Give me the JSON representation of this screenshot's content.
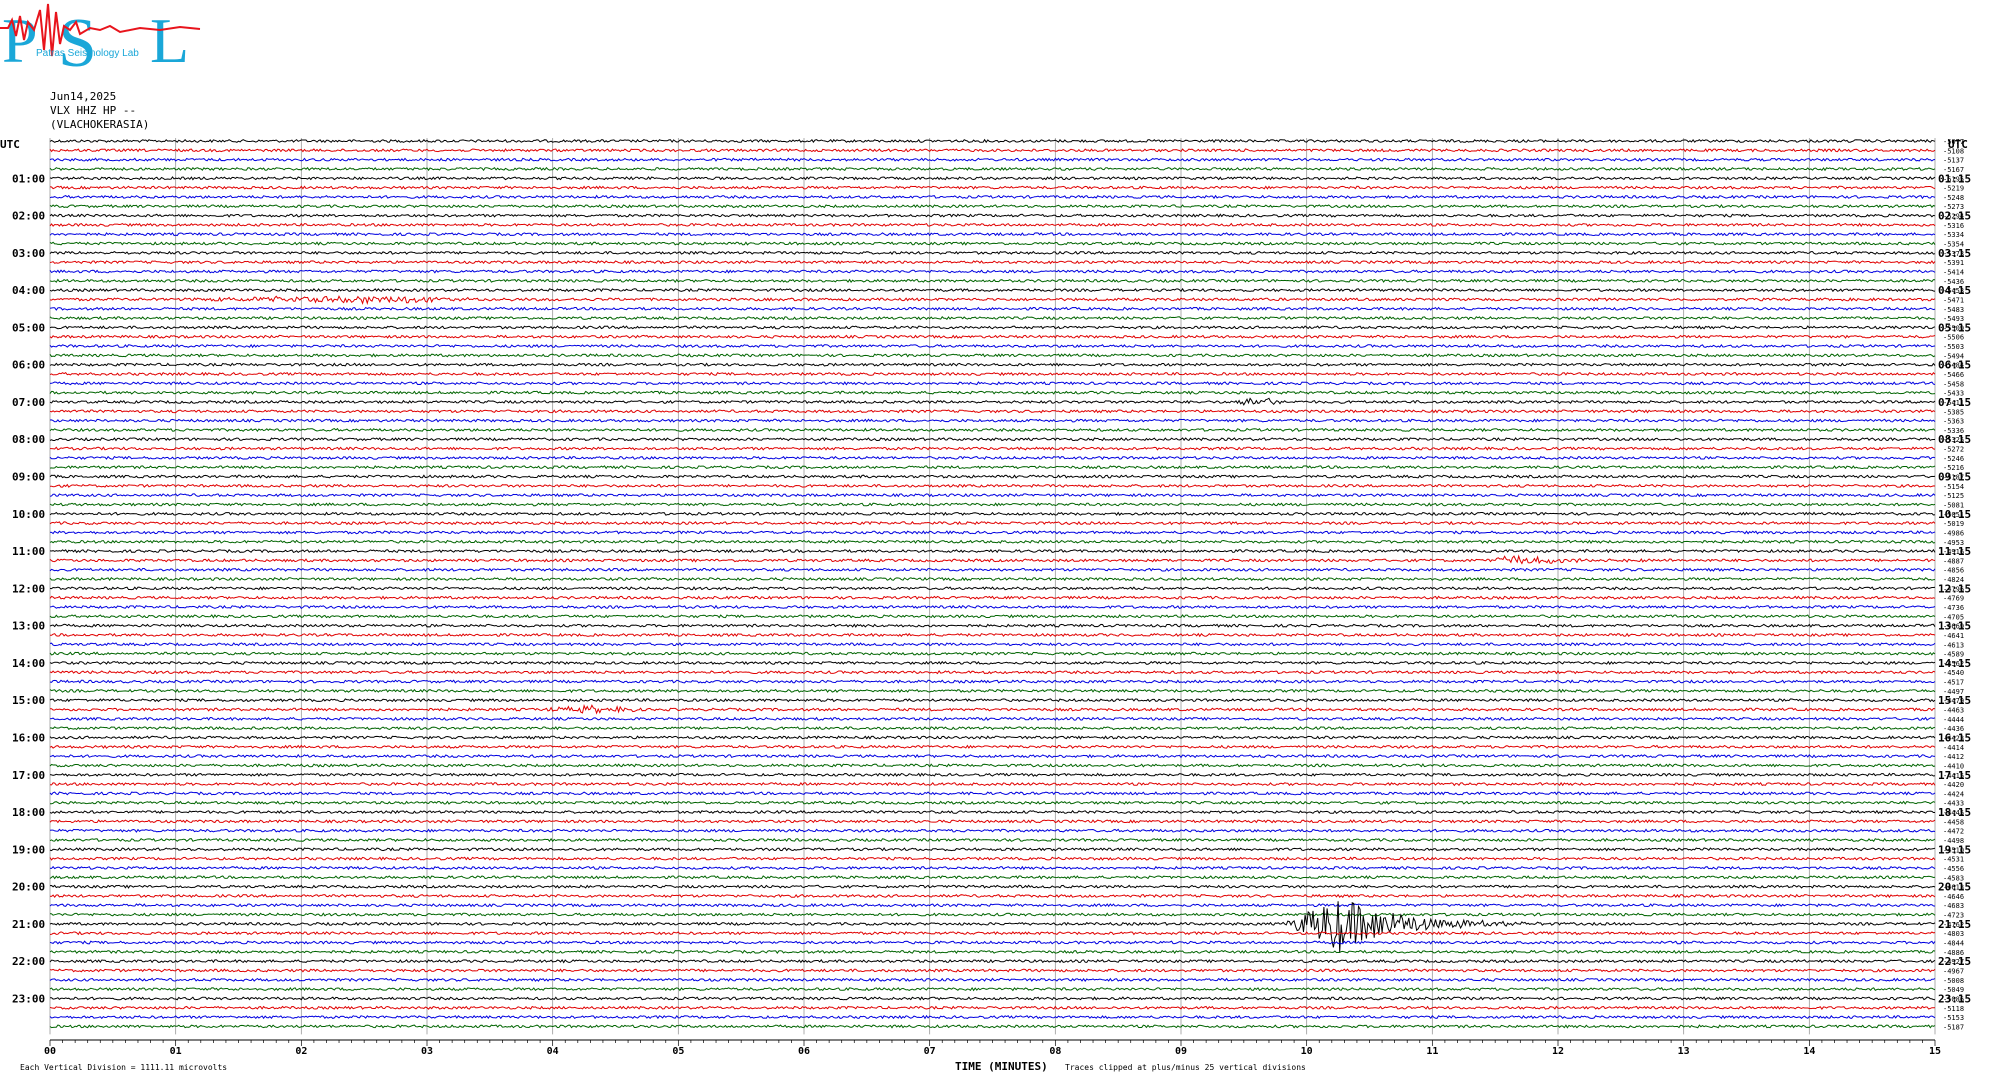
{
  "header": {
    "logo_text": "PSL",
    "logo_subtext": "Patras Seismology Lab",
    "date": "Jun14,2025",
    "channel": "VLX HHZ HP --",
    "station": "(VLACHOKERASIA)"
  },
  "colors": {
    "trace_cycle": [
      "#000000",
      "#e00000",
      "#0000e0",
      "#006400"
    ],
    "logo_red": "#e8141c",
    "logo_cyan": "#1aa7d8"
  },
  "chart_data": {
    "type": "line",
    "title": "",
    "xlabel": "TIME (MINUTES)",
    "ylabel": "",
    "x_ticks": [
      "00",
      "01",
      "02",
      "03",
      "04",
      "05",
      "06",
      "07",
      "08",
      "09",
      "10",
      "11",
      "12",
      "13",
      "14",
      "15"
    ],
    "xlim": [
      0,
      15
    ],
    "left_axis_label": "UTC",
    "right_axis_label": "UTC",
    "left_hour_labels": [
      "01:00",
      "02:00",
      "03:00",
      "04:00",
      "05:00",
      "06:00",
      "07:00",
      "08:00",
      "09:00",
      "10:00",
      "11:00",
      "12:00",
      "13:00",
      "14:00",
      "15:00",
      "16:00",
      "17:00",
      "18:00",
      "19:00",
      "20:00",
      "21:00",
      "22:00",
      "23:00"
    ],
    "right_hour_labels": [
      "01:15",
      "02:15",
      "03:15",
      "04:15",
      "05:15",
      "06:15",
      "07:15",
      "08:15",
      "09:15",
      "10:15",
      "11:15",
      "12:15",
      "13:15",
      "14:15",
      "15:15",
      "16:15",
      "17:15",
      "18:15",
      "19:15",
      "20:15",
      "21:15",
      "22:15",
      "23:15"
    ],
    "trace_offsets": [
      "-5077",
      "-5108",
      "-5137",
      "-5167",
      "-5195",
      "-5219",
      "-5248",
      "-5273",
      "-5294",
      "-5316",
      "-5334",
      "-5354",
      "-5373",
      "-5391",
      "-5414",
      "-5436",
      "-5453",
      "-5471",
      "-5483",
      "-5493",
      "-5509",
      "-5506",
      "-5503",
      "-5494",
      "-5484",
      "-5466",
      "-5458",
      "-5433",
      "-5411",
      "-5385",
      "-5363",
      "-5336",
      "-5325",
      "-5272",
      "-5246",
      "-5216",
      "-5187",
      "-5154",
      "-5125",
      "-5081",
      "-5051",
      "-5019",
      "-4986",
      "-4953",
      "-4916",
      "-4887",
      "-4856",
      "-4824",
      "-4796",
      "-4769",
      "-4736",
      "-4705",
      "-4669",
      "-4641",
      "-4613",
      "-4589",
      "-4562",
      "-4540",
      "-4517",
      "-4497",
      "-4479",
      "-4463",
      "-4444",
      "-4436",
      "-4423",
      "-4414",
      "-4412",
      "-4410",
      "-4415",
      "-4420",
      "-4424",
      "-4433",
      "-4445",
      "-4458",
      "-4472",
      "-4498",
      "-4510",
      "-4531",
      "-4556",
      "-4583",
      "-4613",
      "-4646",
      "-4683",
      "-4723",
      "-4762",
      "-4803",
      "-4844",
      "-4886",
      "-4927",
      "-4967",
      "-5008",
      "-5049",
      "-5086",
      "-5118",
      "-5153",
      "-5187"
    ],
    "trace_count": 96,
    "traces_per_hour": 4,
    "minutes_per_trace": 15,
    "events": [
      {
        "hour": 21,
        "quarter": 0,
        "start_min": 9.8,
        "peak_min": 10.25,
        "end_min": 11.9,
        "amplitude_divisions": 25,
        "color": "red"
      },
      {
        "hour": 7,
        "quarter": 0,
        "start_min": 9.3,
        "peak_min": 9.55,
        "end_min": 9.8,
        "amplitude_divisions": 4,
        "color": "black"
      },
      {
        "hour": 11,
        "quarter": 1,
        "start_min": 11.45,
        "peak_min": 11.6,
        "end_min": 13.0,
        "amplitude_divisions": 4,
        "color": "blue"
      },
      {
        "hour": 15,
        "quarter": 1,
        "start_min": 3.9,
        "peak_min": 4.3,
        "end_min": 4.7,
        "amplitude_divisions": 3,
        "color": "red"
      },
      {
        "hour": 4,
        "quarter": 1,
        "start_min": 0.5,
        "peak_min": 2.8,
        "end_min": 15,
        "amplitude_divisions": 3,
        "color": "red"
      }
    ],
    "grid": true,
    "legend": "none"
  },
  "footer": {
    "scale_note": "Each Vertical Division = 1111.11 microvolts",
    "clip_note": "Traces clipped at plus/minus 25 vertical divisions"
  }
}
